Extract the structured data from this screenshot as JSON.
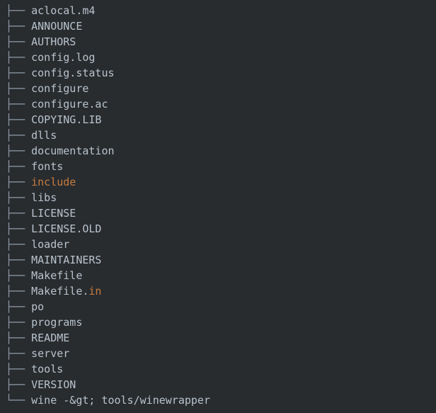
{
  "terminal": {
    "background_color": "#282c2f",
    "text_color": "#b9c2cc",
    "glyph_color": "#8f9aa6",
    "accent_color": "#c77b3f",
    "branch_glyph": "├── ",
    "last_branch_glyph": "└── "
  },
  "tree": {
    "entries": [
      {
        "name": "aclocal.m4",
        "accent": false,
        "last": false
      },
      {
        "name": "ANNOUNCE",
        "accent": false,
        "last": false
      },
      {
        "name": "AUTHORS",
        "accent": false,
        "last": false
      },
      {
        "name": "config.log",
        "accent": false,
        "last": false
      },
      {
        "name": "config.status",
        "accent": false,
        "last": false
      },
      {
        "name": "configure",
        "accent": false,
        "last": false
      },
      {
        "name": "configure.ac",
        "accent": false,
        "last": false
      },
      {
        "name": "COPYING.LIB",
        "accent": false,
        "last": false
      },
      {
        "name": "dlls",
        "accent": false,
        "last": false
      },
      {
        "name": "documentation",
        "accent": false,
        "last": false
      },
      {
        "name": "fonts",
        "accent": false,
        "last": false
      },
      {
        "name": "include",
        "accent": true,
        "last": false
      },
      {
        "name": "libs",
        "accent": false,
        "last": false
      },
      {
        "name": "LICENSE",
        "accent": false,
        "last": false
      },
      {
        "name": "LICENSE.OLD",
        "accent": false,
        "last": false
      },
      {
        "name": "loader",
        "accent": false,
        "last": false
      },
      {
        "name": "MAINTAINERS",
        "accent": false,
        "last": false
      },
      {
        "name": "Makefile",
        "accent": false,
        "last": false
      },
      {
        "name": "Makefile.",
        "accent_part": "in",
        "accent": false,
        "last": false
      },
      {
        "name": "po",
        "accent": false,
        "last": false
      },
      {
        "name": "programs",
        "accent": false,
        "last": false
      },
      {
        "name": "README",
        "accent": false,
        "last": false
      },
      {
        "name": "server",
        "accent": false,
        "last": false
      },
      {
        "name": "tools",
        "accent": false,
        "last": false
      },
      {
        "name": "VERSION",
        "accent": false,
        "last": false
      },
      {
        "name": "wine -&gt; tools/winewrapper",
        "accent": false,
        "last": true
      }
    ]
  }
}
